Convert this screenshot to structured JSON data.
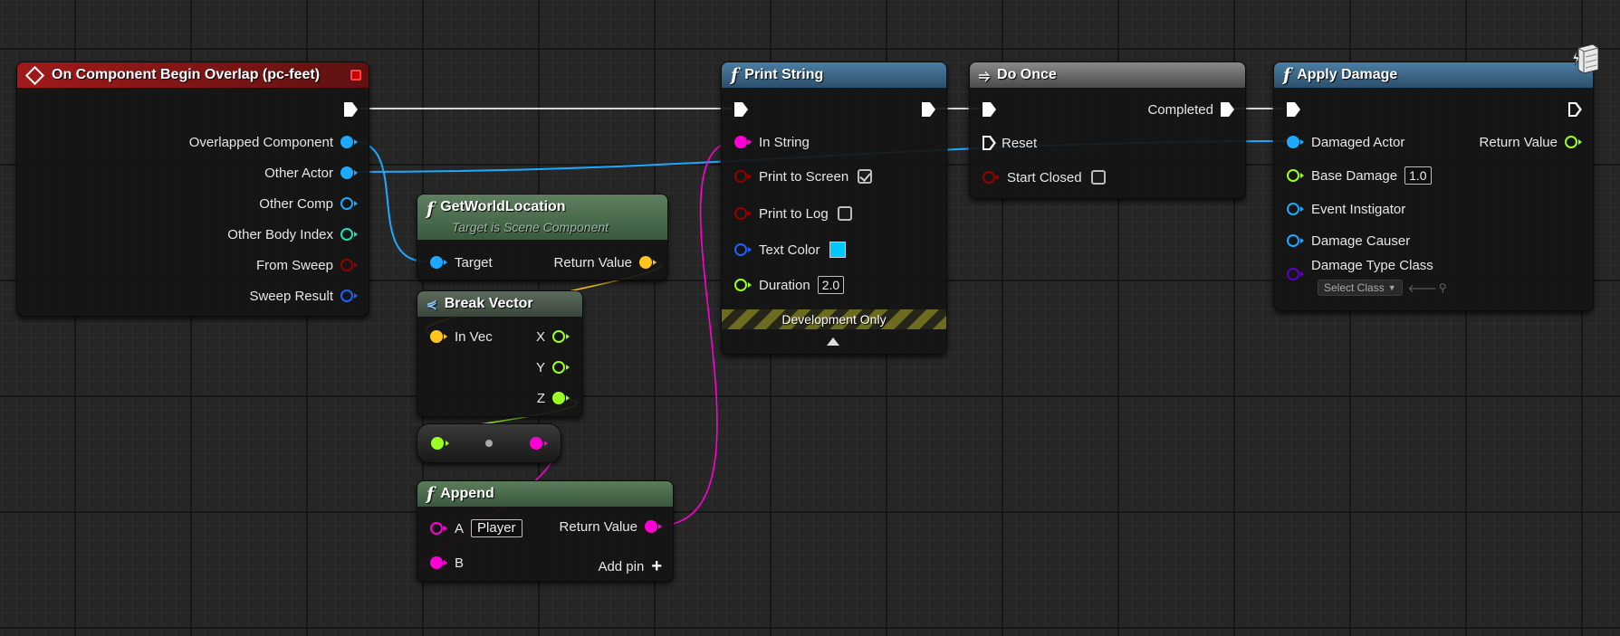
{
  "colors": {
    "exec": "#ffffff",
    "object": "#1ca9ff",
    "struct": "#1c62ff",
    "int": "#1fe2b2",
    "bool": "#930000",
    "vector": "#fdc51d",
    "float": "#9cff22",
    "string": "#fe00d4",
    "class": "#5a00c0",
    "event_header": "#9b1717",
    "func_header": "#3c6a8c",
    "pure_header": "#4a6a4a",
    "macro_header": "#7a7a7a",
    "text_color_swatch": "#00c8ff"
  },
  "nodes": {
    "overlap": {
      "title": "On Component Begin Overlap (pc-feet)",
      "icon": "event-diamond-icon",
      "outputs": [
        "Overlapped Component",
        "Other Actor",
        "Other Comp",
        "Other Body Index",
        "From Sweep",
        "Sweep Result"
      ]
    },
    "getworld": {
      "title": "GetWorldLocation",
      "subtitle": "Target is Scene Component",
      "target": "Target",
      "return_value": "Return Value"
    },
    "breakvec": {
      "title": "Break Vector",
      "in_vec": "In Vec",
      "x": "X",
      "y": "Y",
      "z": "Z"
    },
    "append": {
      "title": "Append",
      "a": "A",
      "a_value": "Player",
      "b": "B",
      "return_value": "Return Value",
      "add_pin": "Add pin"
    },
    "print": {
      "title": "Print String",
      "in_string": "In String",
      "print_to_screen": "Print to Screen",
      "print_to_log": "Print to Log",
      "text_color": "Text Color",
      "duration": "Duration",
      "duration_value": "2.0",
      "dev_only": "Development Only"
    },
    "doonce": {
      "title": "Do Once",
      "completed": "Completed",
      "reset": "Reset",
      "start_closed": "Start Closed"
    },
    "damage": {
      "title": "Apply Damage",
      "damaged_actor": "Damaged Actor",
      "return_value": "Return Value",
      "base_damage": "Base Damage",
      "base_damage_value": "1.0",
      "event_instigator": "Event Instigator",
      "damage_causer": "Damage Causer",
      "damage_type_class": "Damage Type Class",
      "select_class": "Select Class"
    }
  }
}
